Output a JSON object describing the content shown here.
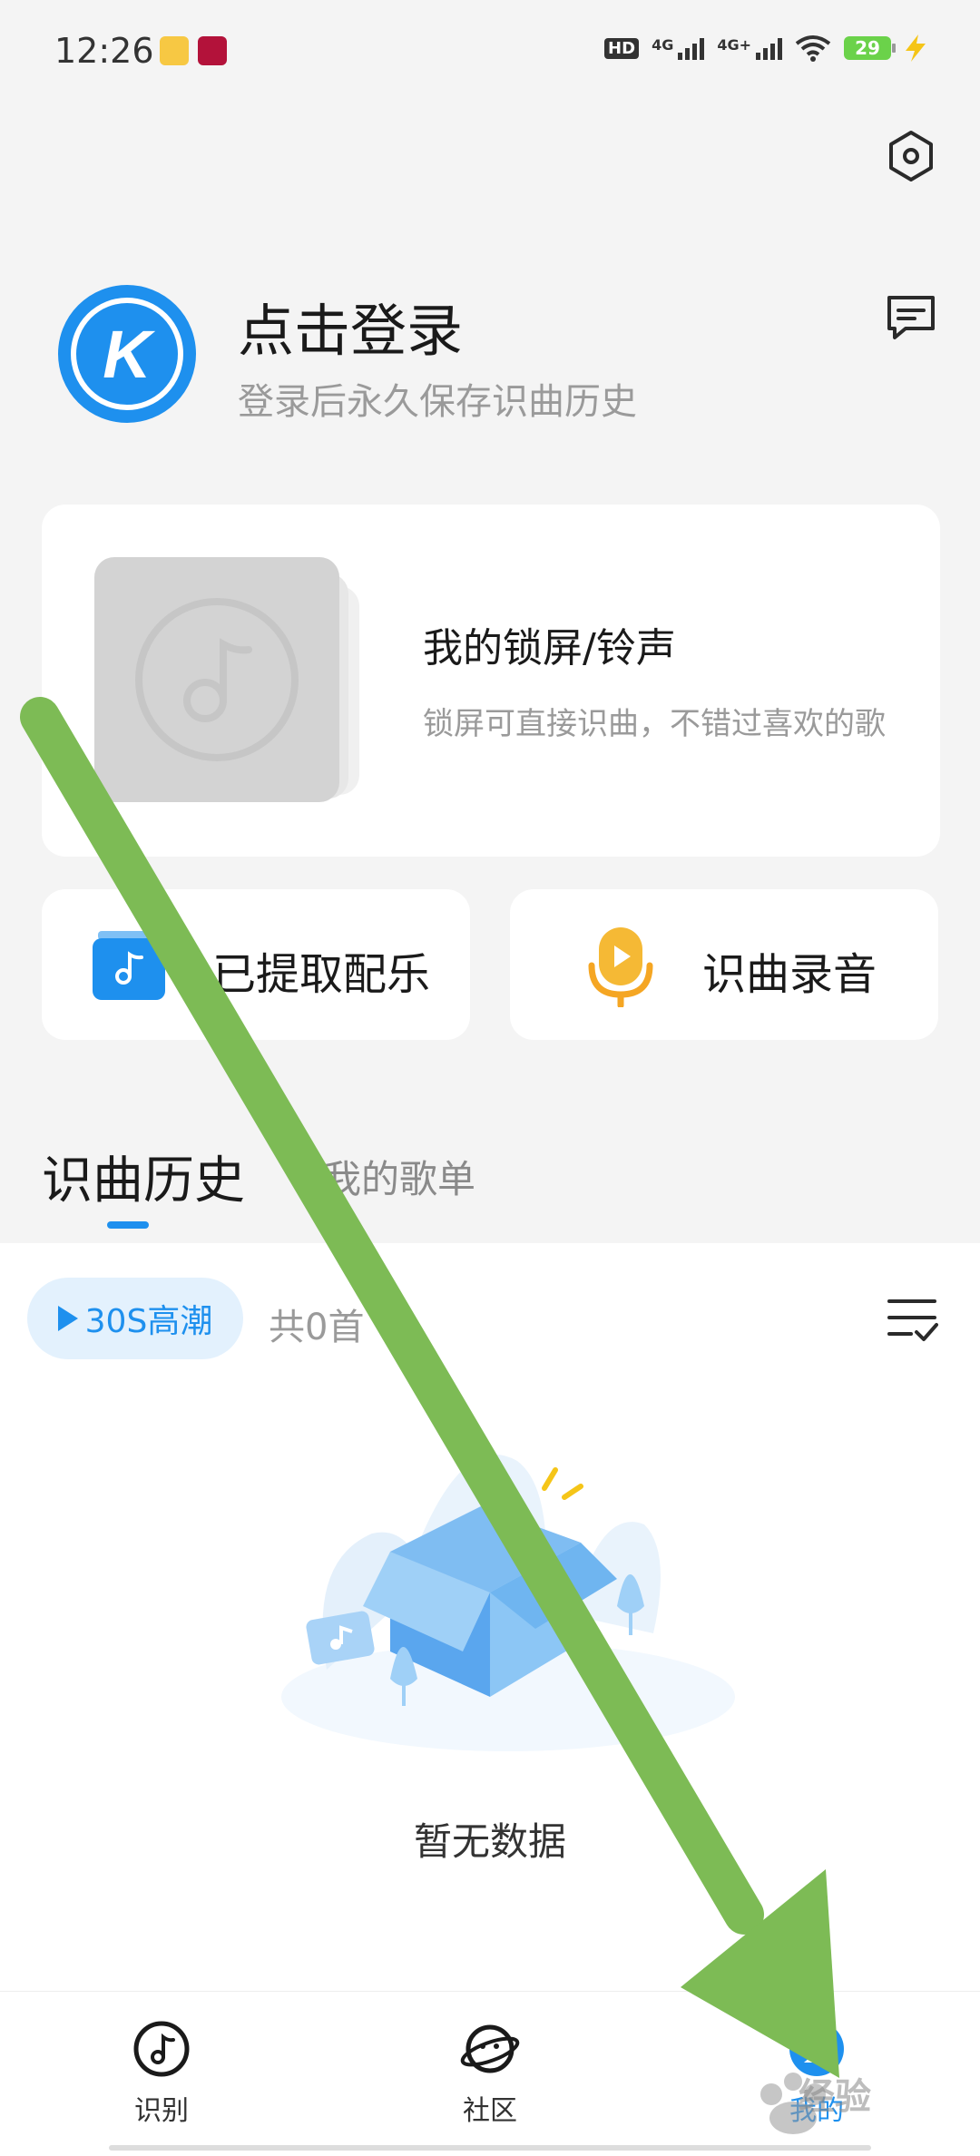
{
  "status_bar": {
    "time": "12:26",
    "network_1": "4G",
    "network_2": "4G+",
    "hd": "HD",
    "battery": "29"
  },
  "header": {
    "avatar_letter": "K",
    "login_title": "点击登录",
    "login_subtitle": "登录后永久保存识曲历史"
  },
  "ringtone_card": {
    "title": "我的锁屏/铃声",
    "subtitle": "锁屏可直接识曲，不错过喜欢的歌"
  },
  "quick_actions": {
    "extract_label": "已提取配乐",
    "record_label": "识曲录音"
  },
  "tabs": {
    "history": "识曲历史",
    "playlist": "我的歌单"
  },
  "history": {
    "chip_label": "30S高潮",
    "count_text": "共0首",
    "empty_text": "暂无数据"
  },
  "bottom_nav": {
    "recognize": "识别",
    "community": "社区",
    "mine": "我的",
    "active": "mine"
  },
  "colors": {
    "accent": "#1e90ee",
    "record_icon": "#f5a623",
    "annotation_arrow": "#7dbb55"
  },
  "watermark": "经验"
}
